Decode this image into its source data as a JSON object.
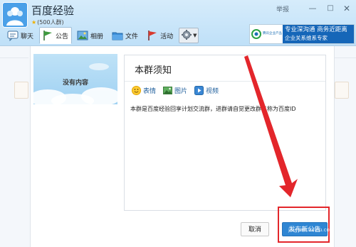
{
  "header": {
    "group_name": "百度经验",
    "member_count": "(500人群)",
    "report_label": "举报"
  },
  "window_controls": {
    "minimize": "—",
    "maximize": "□",
    "close": "✕"
  },
  "tabs": [
    {
      "label": "聊天",
      "icon": "chat-icon"
    },
    {
      "label": "公告",
      "icon": "flag-icon"
    },
    {
      "label": "相册",
      "icon": "photo-album-icon"
    },
    {
      "label": "文件",
      "icon": "folder-icon"
    },
    {
      "label": "活动",
      "icon": "event-flag-icon"
    }
  ],
  "active_tab": "公告",
  "ad": {
    "logo_text": "腾讯企业产品",
    "line1": "专业深沟通  商务近距离",
    "line2": "企业关系维系专家"
  },
  "notice_cover": {
    "text": "没有内容"
  },
  "editor": {
    "title": "本群须知",
    "toolbar": [
      {
        "label": "表情",
        "icon": "smiley-icon"
      },
      {
        "label": "图片",
        "icon": "image-icon"
      },
      {
        "label": "视频",
        "icon": "video-icon"
      }
    ],
    "body": "本群是百度经验回享计划交流群，进群请自觉更改群名称为百度ID"
  },
  "buttons": {
    "cancel": "取消",
    "publish": "发布新公告"
  },
  "watermark": "jingyan.baidu.com",
  "colors": {
    "accent_blue": "#2f86d3",
    "annotation_red": "#e3262b",
    "header_bg": "#cfe8fa"
  }
}
